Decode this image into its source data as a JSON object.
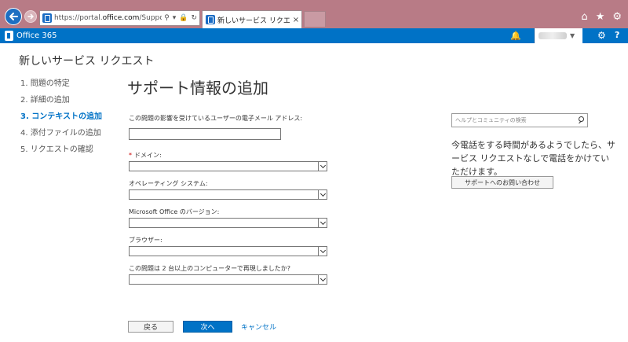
{
  "browser": {
    "url": "https://portal.office.com/Support/NewS",
    "url_domain": "office.com",
    "tab_title": "新しいサービス リクエスト",
    "tab_close": "×"
  },
  "o365": {
    "brand": "Office 365"
  },
  "page": {
    "title": "新しいサービス リクエスト",
    "section_title": "サポート情報の追加"
  },
  "steps": [
    {
      "label": "1.  問題の特定",
      "active": false
    },
    {
      "label": "2.  詳細の追加",
      "active": false
    },
    {
      "label": "3.  コンテキストの追加",
      "active": true
    },
    {
      "label": "4.  添付ファイルの追加",
      "active": false
    },
    {
      "label": "5.  リクエストの確認",
      "active": false
    }
  ],
  "form": {
    "email_label": "この問題の影響を受けているユーザーの電子メール アドレス:",
    "email_value": "",
    "required_mark": "*",
    "domain_label": "ドメイン:",
    "domain_value": "",
    "os_label": "オペレーティング システム:",
    "os_value": "",
    "office_version_label": "Microsoft Office のバージョン:",
    "office_version_value": "",
    "browser_label": "ブラウザー:",
    "browser_value": "",
    "reproduce_label": "この問題は 2 台以上のコンピューターで再現しましたか?",
    "reproduce_value": ""
  },
  "actions": {
    "back": "戻る",
    "next": "次へ",
    "cancel": "キャンセル"
  },
  "help_panel": {
    "search_placeholder": "ヘルプとコミュニティの検索",
    "phone_text": "今電話をする時間があるようでしたら、サービス リクエストなしで電話をかけていただけます。",
    "contact_button": "サポートへのお問い合わせ"
  },
  "colors": {
    "chrome": "#b87b86",
    "o365_bar": "#0072c6",
    "accent": "#0072c6",
    "required": "#cc0000"
  }
}
